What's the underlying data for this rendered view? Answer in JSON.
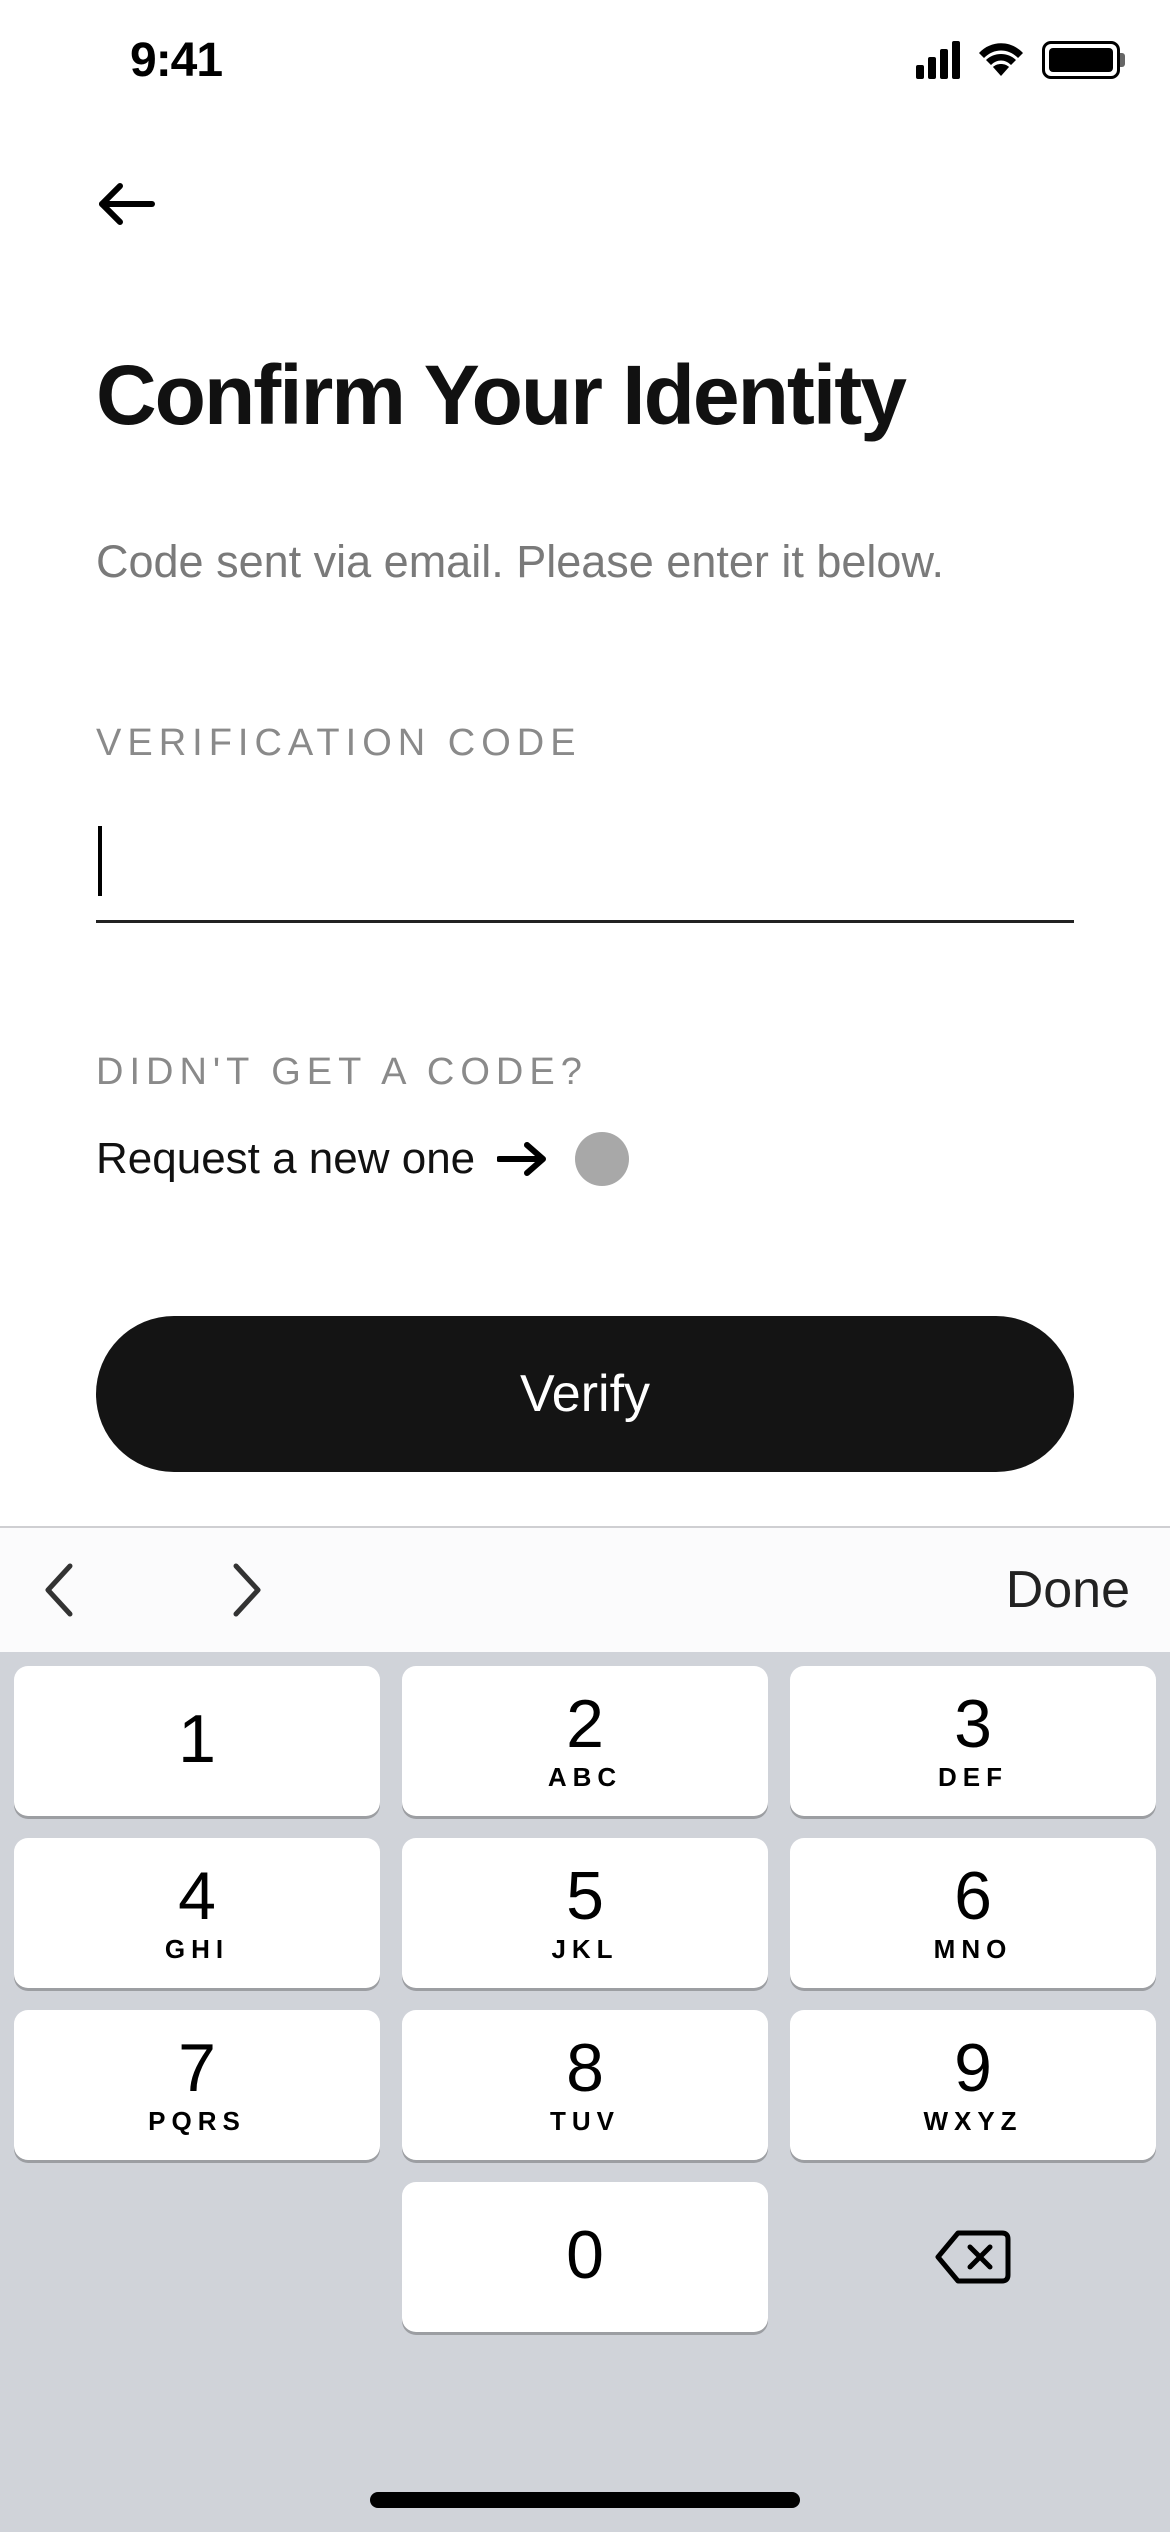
{
  "status_bar": {
    "time": "9:41"
  },
  "main": {
    "title": "Confirm Your Identity",
    "subtitle": "Code sent via email. Please enter it below.",
    "field_label": "VERIFICATION CODE",
    "field_value": "",
    "resend_label": "DIDN'T GET A CODE?",
    "resend_link": "Request a new one",
    "verify_button": "Verify"
  },
  "keyboard": {
    "done": "Done",
    "keys": [
      {
        "d": "1",
        "l": ""
      },
      {
        "d": "2",
        "l": "ABC"
      },
      {
        "d": "3",
        "l": "DEF"
      },
      {
        "d": "4",
        "l": "GHI"
      },
      {
        "d": "5",
        "l": "JKL"
      },
      {
        "d": "6",
        "l": "MNO"
      },
      {
        "d": "7",
        "l": "PQRS"
      },
      {
        "d": "8",
        "l": "TUV"
      },
      {
        "d": "9",
        "l": "WXYZ"
      },
      {
        "d": "0",
        "l": ""
      }
    ]
  }
}
